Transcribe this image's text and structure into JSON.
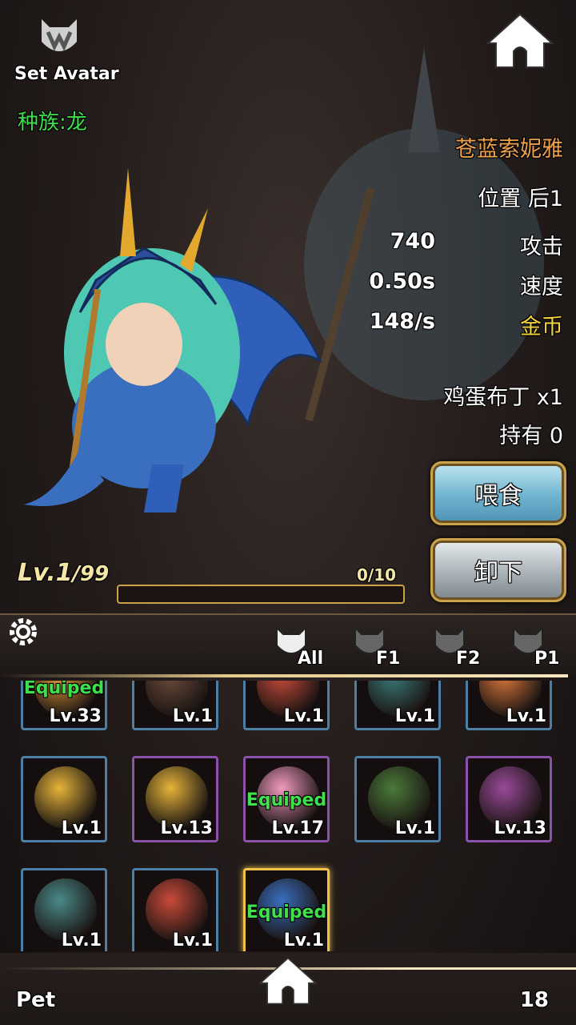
{
  "header": {
    "set_avatar_label": "Set Avatar",
    "race_label": "种族:龙",
    "home_icon": "home-icon"
  },
  "pet": {
    "name": "苍蓝索妮雅",
    "position": "位置 后1",
    "stats": [
      {
        "value": "740",
        "label": "攻击"
      },
      {
        "value": "0.50s",
        "label": "速度"
      },
      {
        "value": "148/s",
        "label": "金币"
      }
    ],
    "food_item": "鸡蛋布丁 x1",
    "owned": "持有 0",
    "level": "Lv.1",
    "max_level": "/99",
    "exp_text": "0/10",
    "exp_progress": 0
  },
  "buttons": {
    "feed": "喂食",
    "unload": "卸下"
  },
  "filters": [
    {
      "label": "All",
      "active": true
    },
    {
      "label": "F1",
      "active": false
    },
    {
      "label": "F2",
      "active": false
    },
    {
      "label": "P1",
      "active": false
    }
  ],
  "grid": [
    {
      "level": "Lv.33",
      "frame": "blue",
      "equipped": "Equiped"
    },
    {
      "level": "Lv.1",
      "frame": "blue",
      "equipped": ""
    },
    {
      "level": "Lv.1",
      "frame": "blue",
      "equipped": ""
    },
    {
      "level": "Lv.1",
      "frame": "blue",
      "equipped": ""
    },
    {
      "level": "Lv.1",
      "frame": "blue",
      "equipped": ""
    },
    {
      "level": "Lv.1",
      "frame": "blue",
      "equipped": ""
    },
    {
      "level": "Lv.13",
      "frame": "purple",
      "equipped": ""
    },
    {
      "level": "Lv.17",
      "frame": "purple",
      "equipped": "Equiped"
    },
    {
      "level": "Lv.1",
      "frame": "blue",
      "equipped": ""
    },
    {
      "level": "Lv.13",
      "frame": "purple",
      "equipped": ""
    },
    {
      "level": "Lv.1",
      "frame": "blue",
      "equipped": ""
    },
    {
      "level": "Lv.1",
      "frame": "blue",
      "equipped": ""
    },
    {
      "level": "Lv.1",
      "frame": "gold",
      "equipped": "Equiped"
    }
  ],
  "footer": {
    "title": "Pet",
    "count": "18"
  },
  "colors": {
    "name": "#f0a24b",
    "race": "#3fe04c",
    "gold_label": "#f2d23b",
    "frame_gold": "#f0c24a"
  }
}
